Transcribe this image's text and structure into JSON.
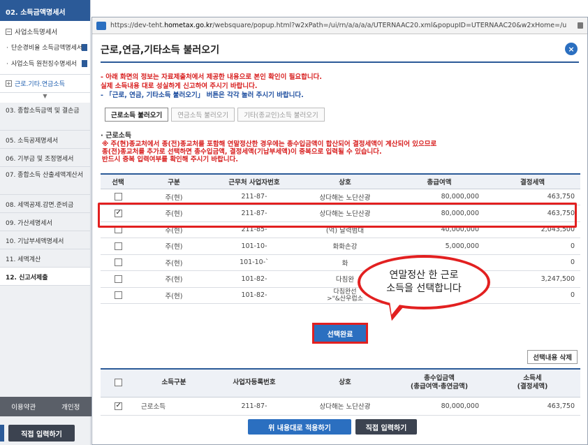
{
  "sidebar": {
    "header": "02. 소득금액명세서",
    "sub_title": "사업소득명세서",
    "leaf_1": "단순경비율 소득금액명세서",
    "leaf_2": "사업소득 원천징수명세서",
    "expand_item": "근로.기타.연금소득",
    "items": [
      "03. 종합소득금액 및 결손금",
      "05. 소득공제명세서",
      "06. 기부금 및 조정명세서",
      "07. 종합소득 산출세액계산서",
      "08. 세액공제.감면.준비금",
      "09. 가산세명세서",
      "10. 기납부세액명세서",
      "11. 세액계산",
      "12. 신고서제출"
    ],
    "bottom_left": "이용약관",
    "bottom_right": "개인정",
    "direct_input": "직접 입력하기"
  },
  "browser": {
    "url_prefix": "https://dev-teht.",
    "url_host": "hometax.go.kr",
    "url_rest": "/websquare/popup.html?w2xPath=/ui/rn/a/a/a/a/UTERNAAC20.xml&popupID=UTERNAAC20&w2xHome=/u"
  },
  "popup": {
    "title": "근로,연금,기타소득 불러오기",
    "close_icon": "×",
    "notice_lines": [
      "- 아래 화면의 정보는 자료제출처에서 제공한 내용으로 본인 확인이 필요합니다.",
      "  실제 소득내용 대로 성실하게 신고하여 주시기 바랍니다.",
      "- 「근로, 연금, 기타소득 불러오기」 버튼은 각각 눌러 주시기 바랍니다."
    ],
    "tabs": [
      "근로소득 불러오기",
      "연금소득 불러오기",
      "기타(종교인)소득 불러오기"
    ],
    "section_label": "· 근로소득",
    "warning_lines": [
      "※ 주(현)종교처에서 종(전)종교처를 포함해 연말정산한 경우에는 총수입금액이 합산되어 결정세액이 계산되어 있으므로",
      "   종(전)종교처를 추가로 선택하면 총수입금액, 결정세액(기납부세액)이 중복으로 입력될 수 있습니다.",
      "   반드시 중복 입력여부를 확인해 주시기 바랍니다."
    ],
    "income_table": {
      "headers": [
        "선택",
        "구분",
        "근무처 사업자번호",
        "상호",
        "총급여액",
        "결정세액"
      ],
      "rows": [
        {
          "checked": false,
          "type": "주(현)",
          "bizno": "211-87-",
          "name": "상다해논 노단산광",
          "salary": "80,000,000",
          "tax": "463,750"
        },
        {
          "checked": true,
          "type": "주(현)",
          "bizno": "211-87-",
          "name": "상다해논 노단산광",
          "salary": "80,000,000",
          "tax": "463,750"
        },
        {
          "checked": false,
          "type": "주(현)",
          "bizno": "211-85-",
          "name": "(억) 달력범대",
          "salary": "40,000,000",
          "tax": "2,043,500"
        },
        {
          "checked": false,
          "type": "주(현)",
          "bizno": "101-10-",
          "name": "화화손강",
          "salary": "5,000,000",
          "tax": "0"
        },
        {
          "checked": false,
          "type": "주(현)",
          "bizno": "101-10-`",
          "name": "화",
          "salary": "",
          "tax": "0"
        },
        {
          "checked": false,
          "type": "주(현)",
          "bizno": "101-82-",
          "name": "다침완",
          "salary": "",
          "tax": "3,247,500"
        },
        {
          "checked": false,
          "type": "주(현)",
          "bizno": "101-82-",
          "name": "다침완선\n>\"&산우럽소",
          "salary": "",
          "tax": "0"
        }
      ]
    },
    "callout_line_1": "연말정산 한 근로",
    "callout_line_2": "소득을 선택합니다",
    "confirm_button": "선택완료",
    "delete_button": "선택내용 삭제",
    "selected_table": {
      "headers": [
        "",
        "소득구분",
        "사업자등록번호",
        "상호",
        "총수입금액\n(총급여액·총연금액)",
        "소득세\n(결정세액)"
      ],
      "rows": [
        {
          "checked": true,
          "kind": "근로소득",
          "bizno": "211-87-",
          "name": "상다해논 노단산광",
          "income": "80,000,000",
          "tax": "463,750"
        }
      ]
    },
    "apply_button": "위 내용대로 적용하기",
    "direct_button": "직접 입력하기"
  },
  "colors": {
    "accent_blue": "#2b6fc0",
    "nav_blue": "#2b5a98",
    "alert_red": "#e22020"
  }
}
